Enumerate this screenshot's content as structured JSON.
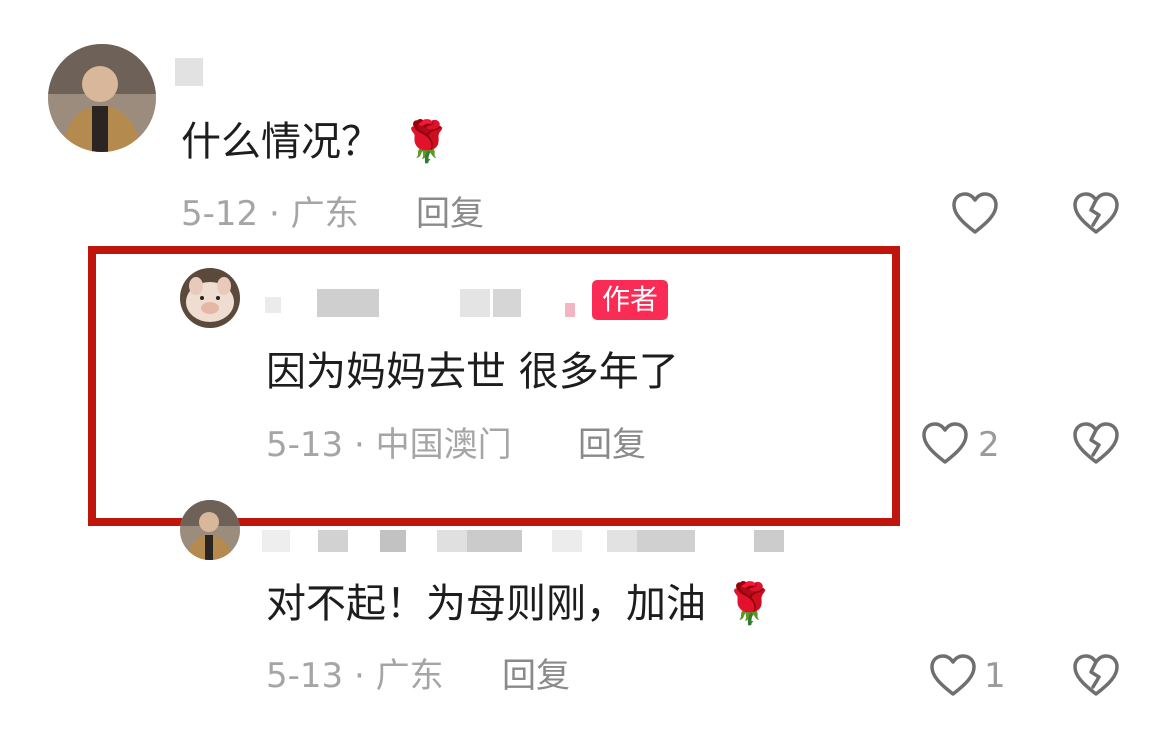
{
  "comments": [
    {
      "content": "什么情况？",
      "emoji": "🌹",
      "date_location": "5-12 · 广东",
      "reply_label": "回复",
      "like_count": ""
    },
    {
      "content": "因为妈妈去世 很多年了",
      "badge": "作者",
      "date_location": "5-13 · 中国澳门",
      "reply_label": "回复",
      "like_count": "2"
    },
    {
      "content": "对不起！为母则刚，加油",
      "emoji": "🌹",
      "date_location": "5-13 · 广东",
      "reply_label": "回复",
      "like_count": "1"
    }
  ],
  "icons": {
    "like": "heart-outline-icon",
    "dislike": "broken-heart-icon"
  },
  "colors": {
    "highlight_border": "#c0150d",
    "author_badge": "#fa2c55",
    "meta_text": "#a5a5a5"
  }
}
